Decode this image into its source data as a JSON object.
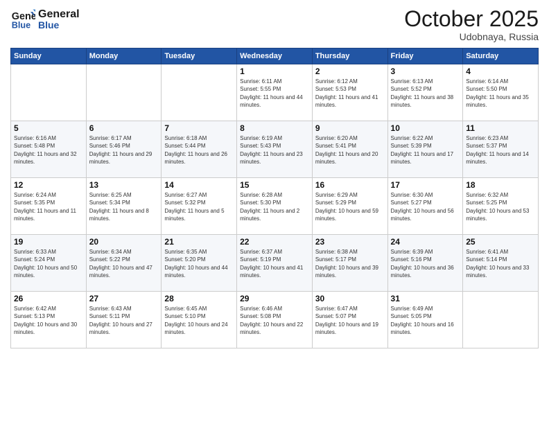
{
  "logo": {
    "line1": "General",
    "line2": "Blue"
  },
  "title": "October 2025",
  "location": "Udobnaya, Russia",
  "days_of_week": [
    "Sunday",
    "Monday",
    "Tuesday",
    "Wednesday",
    "Thursday",
    "Friday",
    "Saturday"
  ],
  "weeks": [
    [
      {
        "day": "",
        "info": ""
      },
      {
        "day": "",
        "info": ""
      },
      {
        "day": "",
        "info": ""
      },
      {
        "day": "1",
        "info": "Sunrise: 6:11 AM\nSunset: 5:55 PM\nDaylight: 11 hours and 44 minutes."
      },
      {
        "day": "2",
        "info": "Sunrise: 6:12 AM\nSunset: 5:53 PM\nDaylight: 11 hours and 41 minutes."
      },
      {
        "day": "3",
        "info": "Sunrise: 6:13 AM\nSunset: 5:52 PM\nDaylight: 11 hours and 38 minutes."
      },
      {
        "day": "4",
        "info": "Sunrise: 6:14 AM\nSunset: 5:50 PM\nDaylight: 11 hours and 35 minutes."
      }
    ],
    [
      {
        "day": "5",
        "info": "Sunrise: 6:16 AM\nSunset: 5:48 PM\nDaylight: 11 hours and 32 minutes."
      },
      {
        "day": "6",
        "info": "Sunrise: 6:17 AM\nSunset: 5:46 PM\nDaylight: 11 hours and 29 minutes."
      },
      {
        "day": "7",
        "info": "Sunrise: 6:18 AM\nSunset: 5:44 PM\nDaylight: 11 hours and 26 minutes."
      },
      {
        "day": "8",
        "info": "Sunrise: 6:19 AM\nSunset: 5:43 PM\nDaylight: 11 hours and 23 minutes."
      },
      {
        "day": "9",
        "info": "Sunrise: 6:20 AM\nSunset: 5:41 PM\nDaylight: 11 hours and 20 minutes."
      },
      {
        "day": "10",
        "info": "Sunrise: 6:22 AM\nSunset: 5:39 PM\nDaylight: 11 hours and 17 minutes."
      },
      {
        "day": "11",
        "info": "Sunrise: 6:23 AM\nSunset: 5:37 PM\nDaylight: 11 hours and 14 minutes."
      }
    ],
    [
      {
        "day": "12",
        "info": "Sunrise: 6:24 AM\nSunset: 5:35 PM\nDaylight: 11 hours and 11 minutes."
      },
      {
        "day": "13",
        "info": "Sunrise: 6:25 AM\nSunset: 5:34 PM\nDaylight: 11 hours and 8 minutes."
      },
      {
        "day": "14",
        "info": "Sunrise: 6:27 AM\nSunset: 5:32 PM\nDaylight: 11 hours and 5 minutes."
      },
      {
        "day": "15",
        "info": "Sunrise: 6:28 AM\nSunset: 5:30 PM\nDaylight: 11 hours and 2 minutes."
      },
      {
        "day": "16",
        "info": "Sunrise: 6:29 AM\nSunset: 5:29 PM\nDaylight: 10 hours and 59 minutes."
      },
      {
        "day": "17",
        "info": "Sunrise: 6:30 AM\nSunset: 5:27 PM\nDaylight: 10 hours and 56 minutes."
      },
      {
        "day": "18",
        "info": "Sunrise: 6:32 AM\nSunset: 5:25 PM\nDaylight: 10 hours and 53 minutes."
      }
    ],
    [
      {
        "day": "19",
        "info": "Sunrise: 6:33 AM\nSunset: 5:24 PM\nDaylight: 10 hours and 50 minutes."
      },
      {
        "day": "20",
        "info": "Sunrise: 6:34 AM\nSunset: 5:22 PM\nDaylight: 10 hours and 47 minutes."
      },
      {
        "day": "21",
        "info": "Sunrise: 6:35 AM\nSunset: 5:20 PM\nDaylight: 10 hours and 44 minutes."
      },
      {
        "day": "22",
        "info": "Sunrise: 6:37 AM\nSunset: 5:19 PM\nDaylight: 10 hours and 41 minutes."
      },
      {
        "day": "23",
        "info": "Sunrise: 6:38 AM\nSunset: 5:17 PM\nDaylight: 10 hours and 39 minutes."
      },
      {
        "day": "24",
        "info": "Sunrise: 6:39 AM\nSunset: 5:16 PM\nDaylight: 10 hours and 36 minutes."
      },
      {
        "day": "25",
        "info": "Sunrise: 6:41 AM\nSunset: 5:14 PM\nDaylight: 10 hours and 33 minutes."
      }
    ],
    [
      {
        "day": "26",
        "info": "Sunrise: 6:42 AM\nSunset: 5:13 PM\nDaylight: 10 hours and 30 minutes."
      },
      {
        "day": "27",
        "info": "Sunrise: 6:43 AM\nSunset: 5:11 PM\nDaylight: 10 hours and 27 minutes."
      },
      {
        "day": "28",
        "info": "Sunrise: 6:45 AM\nSunset: 5:10 PM\nDaylight: 10 hours and 24 minutes."
      },
      {
        "day": "29",
        "info": "Sunrise: 6:46 AM\nSunset: 5:08 PM\nDaylight: 10 hours and 22 minutes."
      },
      {
        "day": "30",
        "info": "Sunrise: 6:47 AM\nSunset: 5:07 PM\nDaylight: 10 hours and 19 minutes."
      },
      {
        "day": "31",
        "info": "Sunrise: 6:49 AM\nSunset: 5:05 PM\nDaylight: 10 hours and 16 minutes."
      },
      {
        "day": "",
        "info": ""
      }
    ]
  ]
}
